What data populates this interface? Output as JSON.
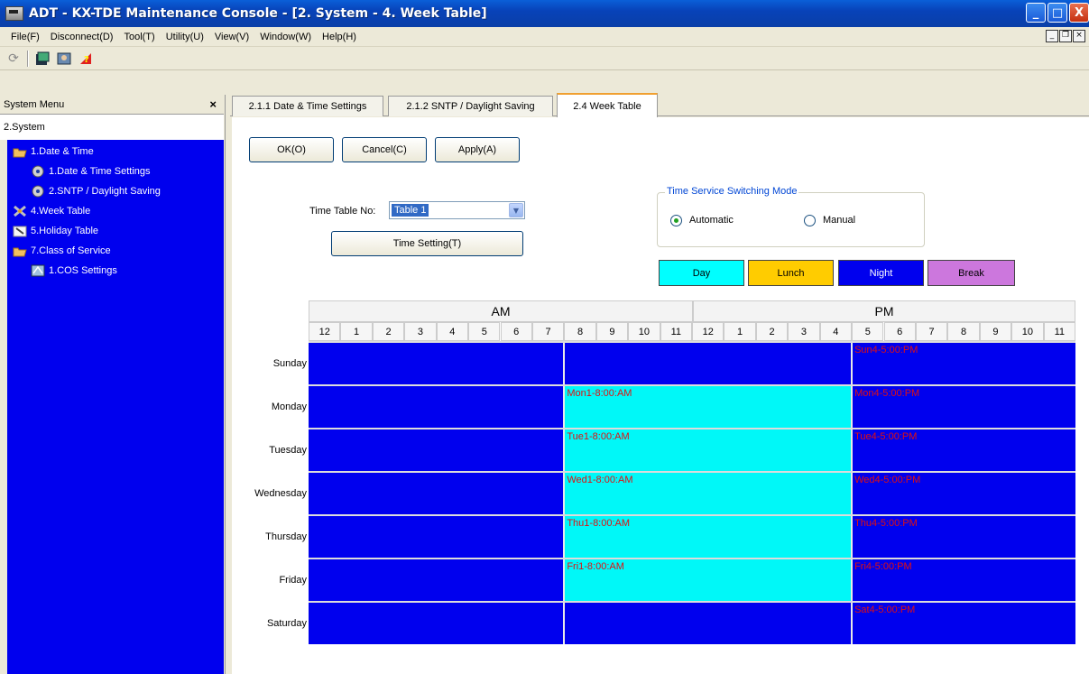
{
  "window": {
    "title": "ADT - KX-TDE Maintenance Console - [2. System - 4. Week Table]"
  },
  "menubar": {
    "items": [
      "File(F)",
      "Disconnect(D)",
      "Tool(T)",
      "Utility(U)",
      "View(V)",
      "Window(W)",
      "Help(H)"
    ]
  },
  "left_panel": {
    "header": "System Menu",
    "close_label": "×",
    "root_label": "2.System",
    "tree": [
      {
        "label": "1.Date & Time"
      },
      {
        "label": "1.Date & Time Settings"
      },
      {
        "label": "2.SNTP / Daylight Saving"
      },
      {
        "label": "4.Week Table"
      },
      {
        "label": "5.Holiday Table"
      },
      {
        "label": "7.Class of Service"
      },
      {
        "label": "1.COS Settings"
      }
    ]
  },
  "tabs": [
    {
      "label": "2.1.1 Date & Time Settings"
    },
    {
      "label": "2.1.2 SNTP / Daylight Saving"
    },
    {
      "label": "2.4 Week Table"
    }
  ],
  "buttons": {
    "ok": "OK(O)",
    "cancel": "Cancel(C)",
    "apply": "Apply(A)",
    "time_setting": "Time Setting(T)"
  },
  "time_table": {
    "label": "Time Table No:",
    "selected": "Table 1"
  },
  "switching_mode": {
    "title": "Time Service Switching Mode",
    "automatic": "Automatic",
    "manual": "Manual",
    "selected": "Automatic"
  },
  "legend": [
    {
      "label": "Day",
      "color": "#00ffff",
      "text_color": "#000000"
    },
    {
      "label": "Lunch",
      "color": "#ffcc00",
      "text_color": "#000000"
    },
    {
      "label": "Night",
      "color": "#0000ee",
      "text_color": "#ffffff"
    },
    {
      "label": "Break",
      "color": "#cc77dd",
      "text_color": "#000000"
    }
  ],
  "grid": {
    "am_label": "AM",
    "pm_label": "PM",
    "hours": [
      "12",
      "1",
      "2",
      "3",
      "4",
      "5",
      "6",
      "7",
      "8",
      "9",
      "10",
      "11",
      "12",
      "1",
      "2",
      "3",
      "4",
      "5",
      "6",
      "7",
      "8",
      "9",
      "10",
      "11"
    ],
    "days": [
      {
        "name": "Sunday",
        "day_label": "",
        "night_label": "Sun4-5:00:PM"
      },
      {
        "name": "Monday",
        "day_label": "Mon1-8:00:AM",
        "night_label": "Mon4-5:00:PM"
      },
      {
        "name": "Tuesday",
        "day_label": "Tue1-8:00:AM",
        "night_label": "Tue4-5:00:PM"
      },
      {
        "name": "Wednesday",
        "day_label": "Wed1-8:00:AM",
        "night_label": "Wed4-5:00:PM"
      },
      {
        "name": "Thursday",
        "day_label": "Thu1-8:00:AM",
        "night_label": "Thu4-5:00:PM"
      },
      {
        "name": "Friday",
        "day_label": "Fri1-8:00:AM",
        "night_label": "Fri4-5:00:PM"
      },
      {
        "name": "Saturday",
        "day_label": "",
        "night_label": "Sat4-5:00:PM"
      }
    ]
  }
}
